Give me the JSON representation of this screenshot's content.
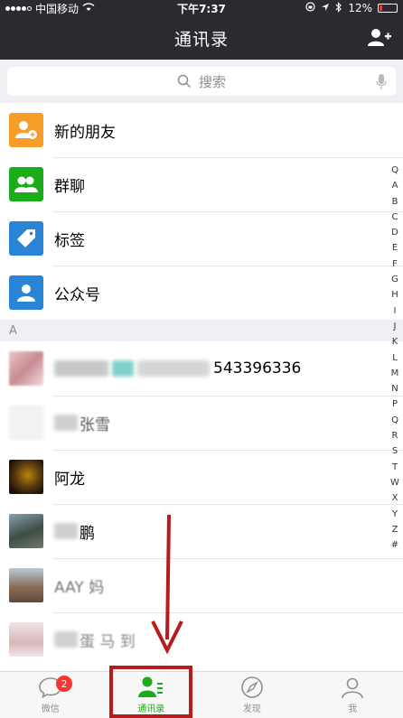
{
  "status_bar": {
    "carrier": "中国移动",
    "time": "下午7:37",
    "battery": "12%"
  },
  "nav": {
    "title": "通讯录"
  },
  "search": {
    "placeholder": "搜索"
  },
  "special_entries": [
    {
      "label": "新的朋友",
      "color": "#f79c28"
    },
    {
      "label": "群聊",
      "color": "#1aad19"
    },
    {
      "label": "标签",
      "color": "#2a85d6"
    },
    {
      "label": "公众号",
      "color": "#2a85d6"
    }
  ],
  "section": {
    "letter": "A"
  },
  "contacts": [
    {
      "visible_text": "543396336"
    },
    {
      "visible_text": "张雪"
    },
    {
      "visible_text": "阿龙"
    },
    {
      "visible_text": "鹏"
    },
    {
      "visible_text": "AAY 妈"
    },
    {
      "visible_text": "蛋 马 到"
    }
  ],
  "index_letters": [
    "Q",
    "A",
    "B",
    "C",
    "D",
    "E",
    "F",
    "G",
    "H",
    "I",
    "J",
    "K",
    "L",
    "M",
    "N",
    "P",
    "Q",
    "R",
    "S",
    "T",
    "W",
    "X",
    "Y",
    "Z",
    "#"
  ],
  "tabs": [
    {
      "label": "微信",
      "badge": "2"
    },
    {
      "label": "通讯录"
    },
    {
      "label": "发现"
    },
    {
      "label": "我"
    }
  ],
  "colors": {
    "accent": "#1aad19",
    "nav_bg": "#2b2a30",
    "annotation": "#b71c1c"
  }
}
